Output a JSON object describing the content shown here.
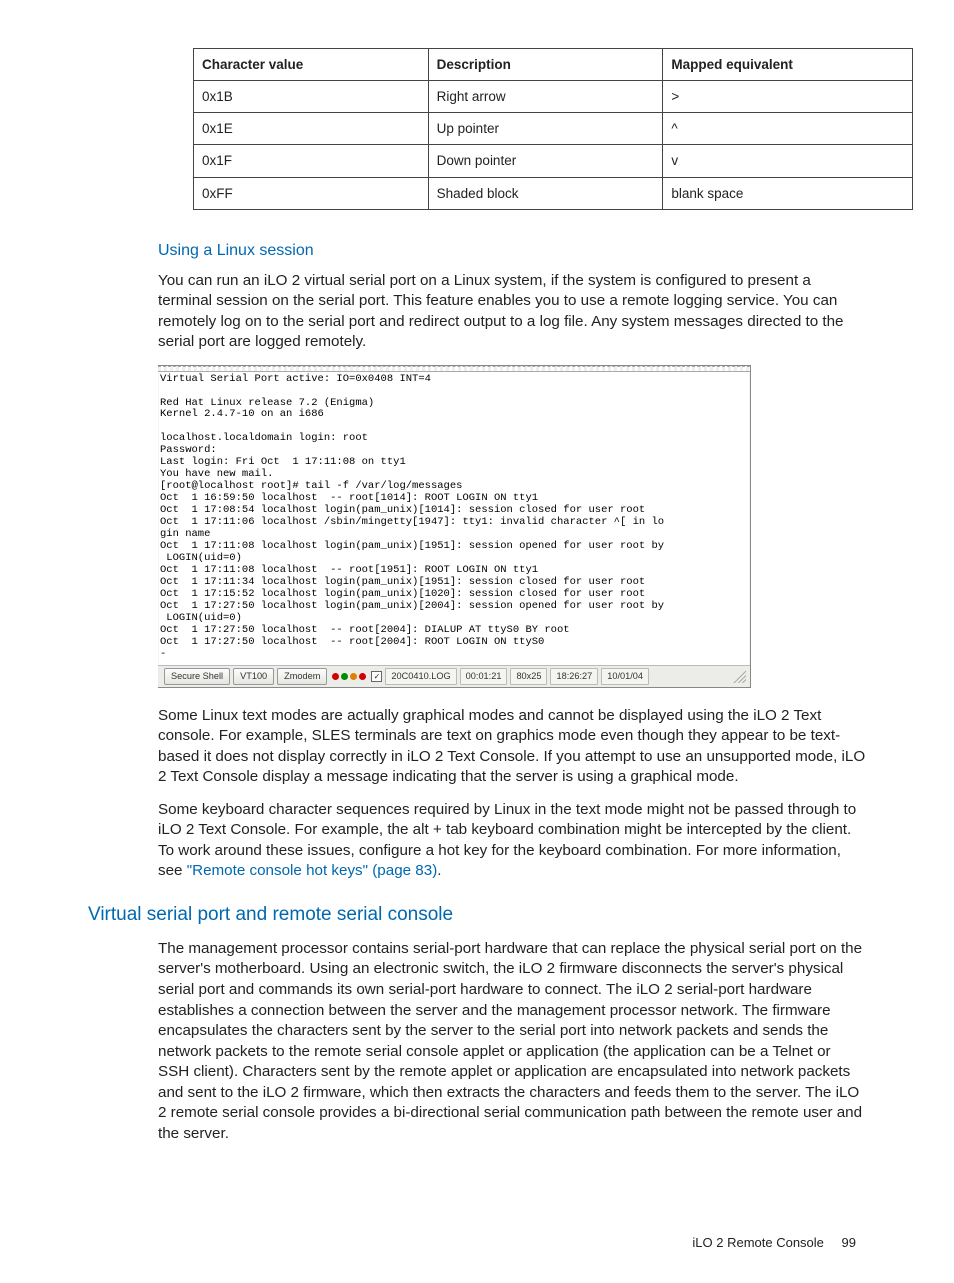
{
  "table": {
    "headers": [
      "Character value",
      "Description",
      "Mapped equivalent"
    ],
    "rows": [
      [
        "0x1B",
        "Right arrow",
        ">"
      ],
      [
        "0x1E",
        "Up pointer",
        "^"
      ],
      [
        "0x1F",
        "Down pointer",
        "v"
      ],
      [
        "0xFF",
        "Shaded block",
        "blank space"
      ]
    ]
  },
  "chart_data": {
    "type": "table",
    "title": "Character value mapping",
    "columns": [
      "Character value",
      "Description",
      "Mapped equivalent"
    ],
    "rows": [
      [
        "0x1B",
        "Right arrow",
        ">"
      ],
      [
        "0x1E",
        "Up pointer",
        "^"
      ],
      [
        "0x1F",
        "Down pointer",
        "v"
      ],
      [
        "0xFF",
        "Shaded block",
        "blank space"
      ]
    ]
  },
  "headings": {
    "linux": "Using a Linux session",
    "vsp": "Virtual serial port and remote serial console"
  },
  "paragraphs": {
    "p1": "You can run an iLO 2 virtual serial port on a Linux system, if the system is configured to present a terminal session on the serial port. This feature enables you to use a remote logging service. You can remotely log on to the serial port and redirect output to a log file. Any system messages directed to the serial port are logged remotely.",
    "p2": "Some Linux text modes are actually graphical modes and cannot be displayed using the iLO 2 Text console. For example, SLES terminals are text on graphics mode even though they appear to be text-based it does not display correctly in iLO 2 Text Console. If you attempt to use an unsupported mode, iLO 2 Text Console display a message indicating that the server is using a graphical mode.",
    "p3a": "Some keyboard character sequences required by Linux in the text mode might not be passed through to iLO 2 Text Console. For example, the alt + tab keyboard combination might be intercepted by the client. To work around these issues, configure a hot key for the keyboard combination. For more information, see ",
    "p3link": "\"Remote console hot keys\" (page 83)",
    "p3b": ".",
    "p4": "The management processor contains serial-port hardware that can replace the physical serial port on the server's motherboard. Using an electronic switch, the iLO 2 firmware disconnects the server's physical serial port and commands its own serial-port hardware to connect. The iLO 2 serial-port hardware establishes a connection between the server and the management processor network. The firmware encapsulates the characters sent by the server to the serial port into network packets and sends the network packets to the remote serial console applet or application (the application can be a Telnet or SSH client). Characters sent by the remote applet or application are encapsulated into network packets and sent to the iLO 2 firmware, which then extracts the characters and feeds them to the server. The iLO 2 remote serial console provides a bi-directional serial communication path between the remote user and the server."
  },
  "terminal": {
    "lines": "Virtual Serial Port active: IO=0x0408 INT=4\n\nRed Hat Linux release 7.2 (Enigma)\nKernel 2.4.7-10 on an i686\n\nlocalhost.localdomain login: root\nPassword:\nLast login: Fri Oct  1 17:11:08 on tty1\nYou have new mail.\n[root@localhost root]# tail -f /var/log/messages\nOct  1 16:59:50 localhost  -- root[1014]: ROOT LOGIN ON tty1\nOct  1 17:08:54 localhost login(pam_unix)[1014]: session closed for user root\nOct  1 17:11:06 localhost /sbin/mingetty[1947]: tty1: invalid character ^[ in lo\ngin name\nOct  1 17:11:08 localhost login(pam_unix)[1951]: session opened for user root by\n LOGIN(uid=0)\nOct  1 17:11:08 localhost  -- root[1951]: ROOT LOGIN ON tty1\nOct  1 17:11:34 localhost login(pam_unix)[1951]: session closed for user root\nOct  1 17:15:52 localhost login(pam_unix)[1020]: session closed for user root\nOct  1 17:27:50 localhost login(pam_unix)[2004]: session opened for user root by\n LOGIN(uid=0)\nOct  1 17:27:50 localhost  -- root[2004]: DIALUP AT ttyS0 BY root\nOct  1 17:27:50 localhost  -- root[2004]: ROOT LOGIN ON ttyS0\n-",
    "status": {
      "btn1": "Secure Shell",
      "btn2": "VT100",
      "btn3": "Zmodem",
      "logfile": "20C0410.LOG",
      "elapsed": "00:01:21",
      "size": "80x25",
      "time": "18:26:27",
      "date": "10/01/04"
    }
  },
  "footer": {
    "section": "iLO 2 Remote Console",
    "page": "99"
  }
}
